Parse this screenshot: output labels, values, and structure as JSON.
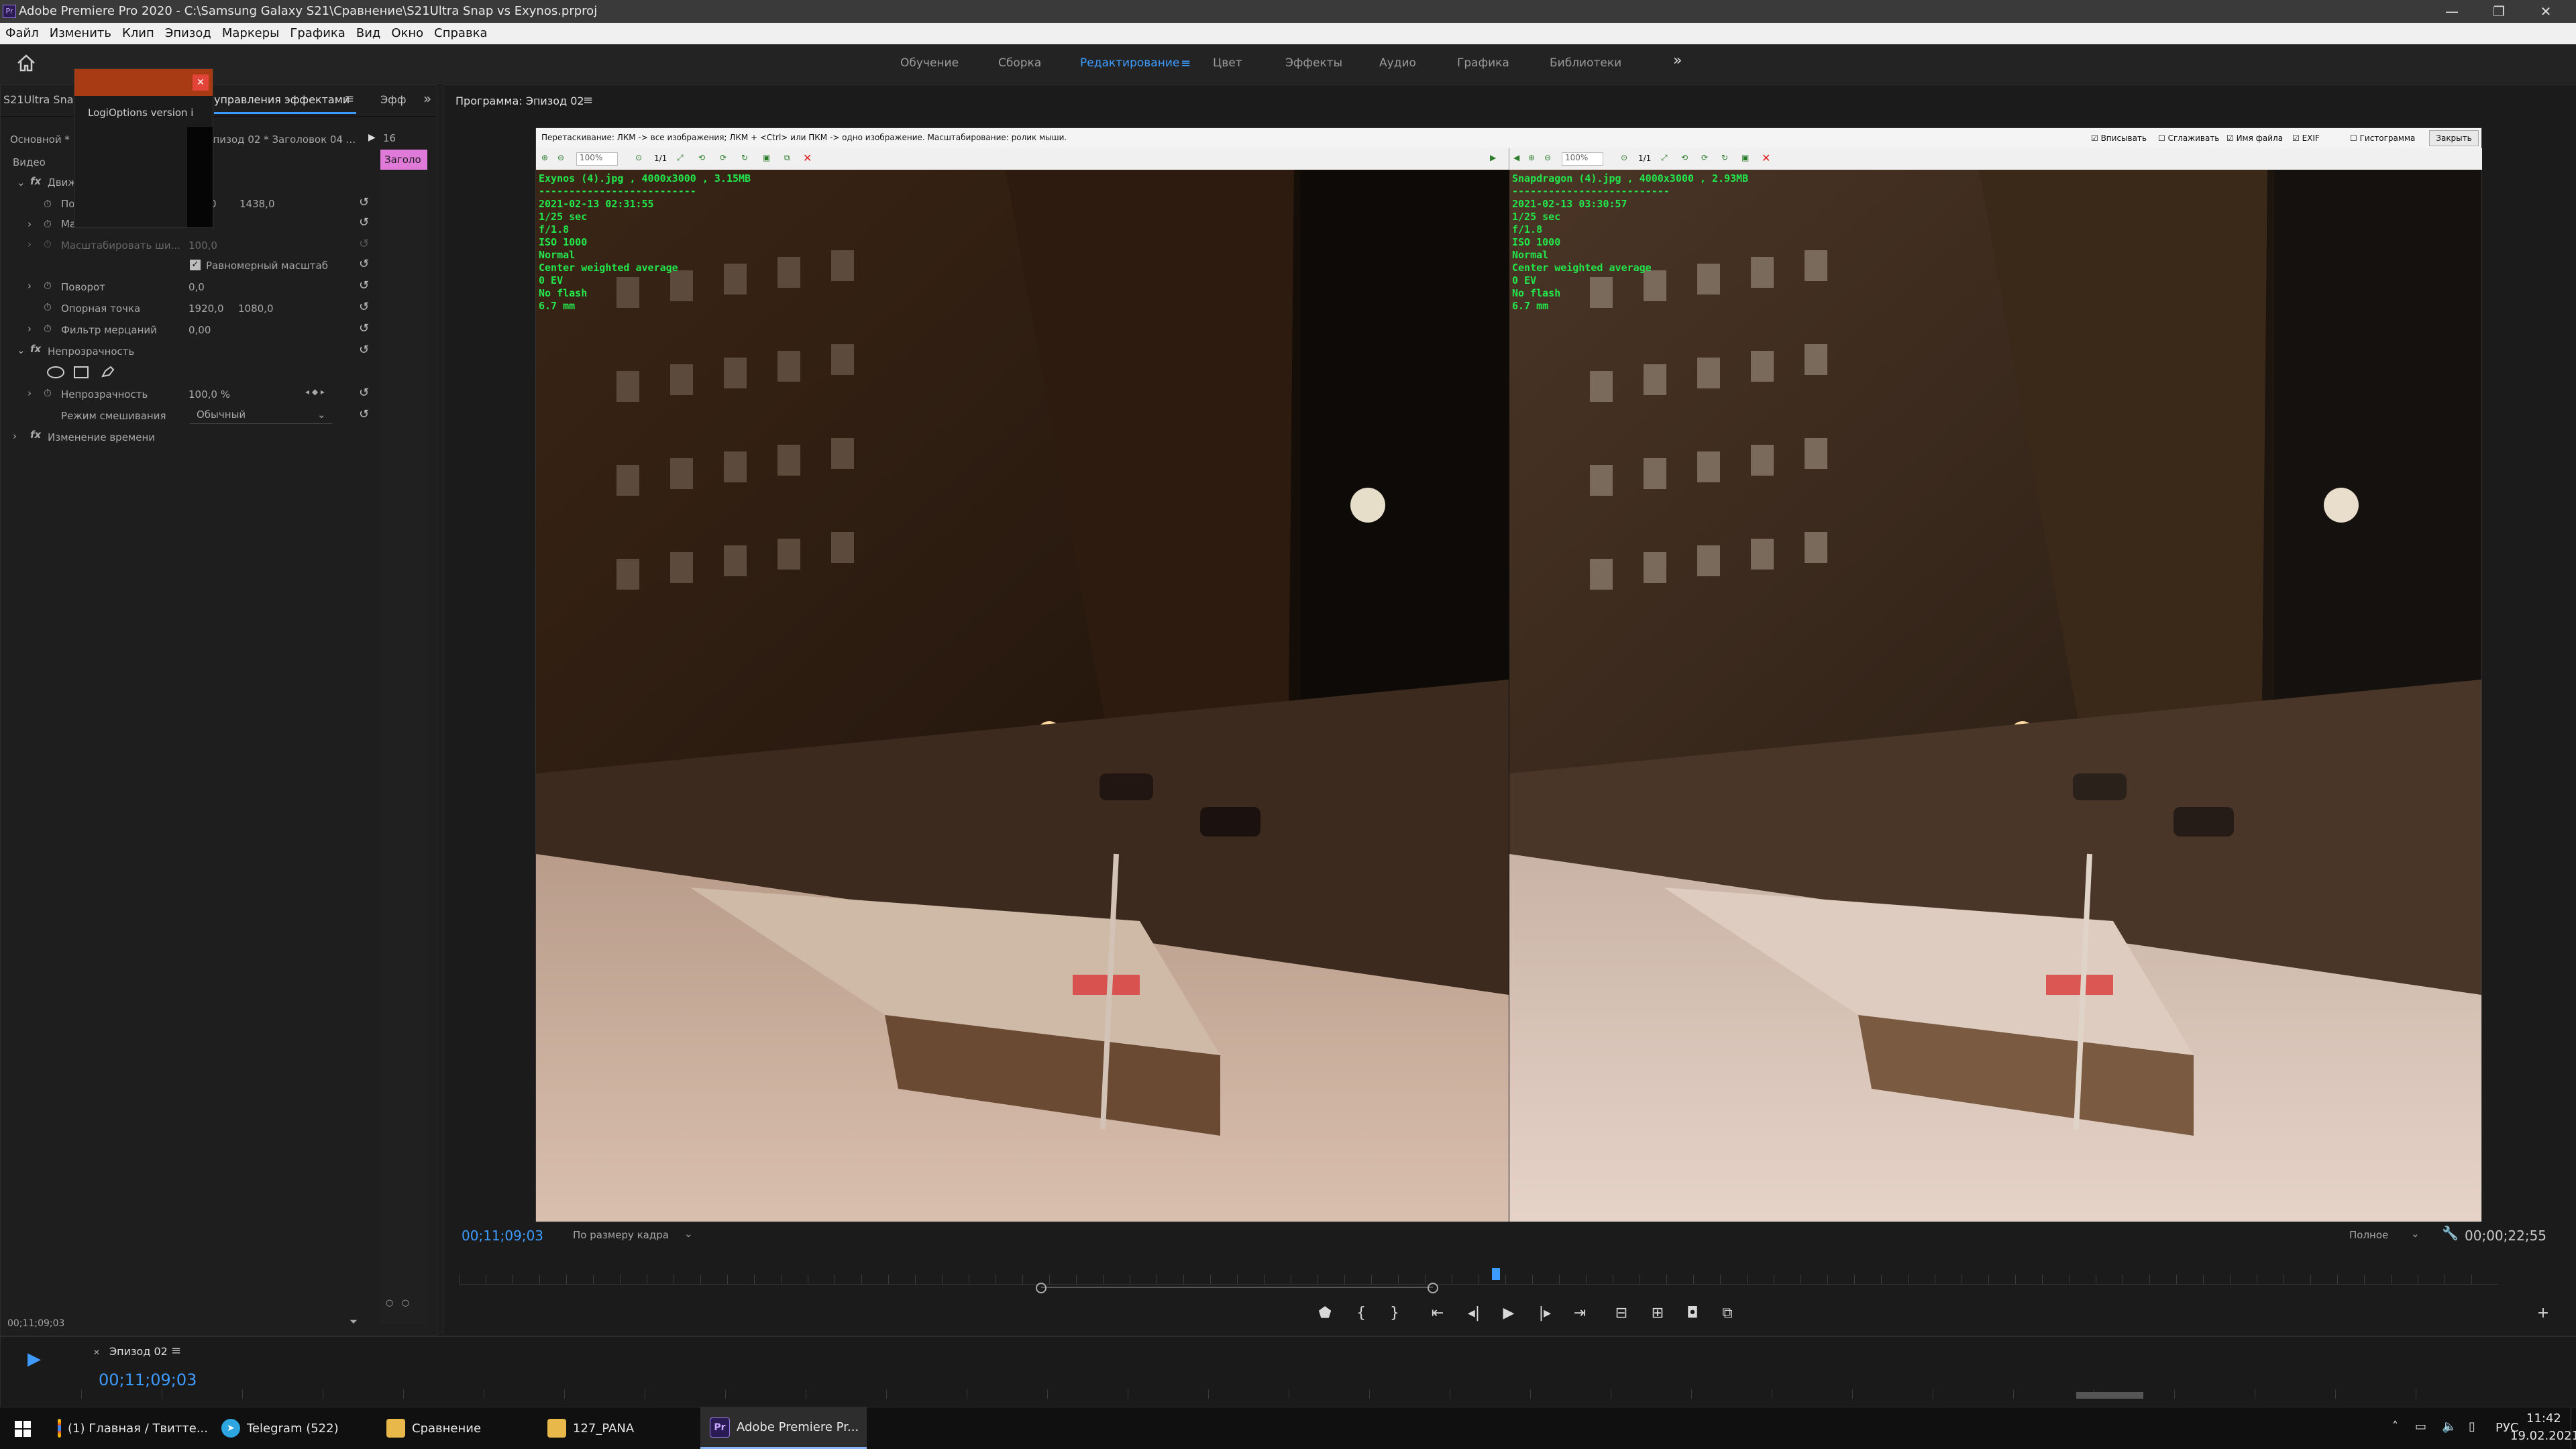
{
  "app": {
    "title": "Adobe Premiere Pro 2020 - C:\\Samsung Galaxy S21\\Сравнение\\S21Ultra Snap vs Exynos.prproj",
    "window_controls": {
      "minimize": "—",
      "maximize": "❐",
      "close": "✕"
    }
  },
  "menu": [
    "Файл",
    "Изменить",
    "Клип",
    "Эпизод",
    "Маркеры",
    "Графика",
    "Вид",
    "Окно",
    "Справка"
  ],
  "workspace": {
    "tabs": [
      "Обучение",
      "Сборка",
      "Редактирование",
      "Цвет",
      "Эффекты",
      "Аудио",
      "Графика",
      "Библиотеки"
    ],
    "active": "Редактирование",
    "more": "»"
  },
  "effect_controls": {
    "source_tab": "S21Ultra Snap vs",
    "panel_tab": "Элементы управления эффектами",
    "panel_tab_short": "управления эффектами",
    "fx_tab": "Эфф",
    "master_label": "Основной *",
    "clip_label": "Эпизод 02 * Заголовок 04 ...",
    "timecode_head": "16",
    "clip_chip": "Заголо",
    "section_video": "Видео",
    "motion": {
      "label": "Движение",
      "label_short": "Движ",
      "position_label": "По",
      "position_x": "0",
      "position_y": "1438,0",
      "scale_label": "Ма",
      "scale_width_label": "Масштабировать ши...",
      "scale_width_value": "100,0",
      "uniform_scale_label": "Равномерный масштаб",
      "rotation_label": "Поворот",
      "rotation_value": "0,0",
      "anchor_label": "Опорная точка",
      "anchor_x": "1920,0",
      "anchor_y": "1080,0",
      "flicker_label": "Фильтр мерцаний",
      "flicker_value": "0,00"
    },
    "opacity": {
      "label": "Непрозрачность",
      "value_label": "Непрозрачность",
      "value": "100,0 %",
      "blend_label": "Режим смешивания",
      "blend_value": "Обычный"
    },
    "time_remap_label": "Изменение времени",
    "footer_timecode": "00;11;09;03"
  },
  "popup": {
    "text": "LogiOptions version i",
    "close": "✕"
  },
  "program": {
    "title": "Программа: Эпизод 02",
    "timecode": "00;11;09;03",
    "fit": "По размеру кадра",
    "quality": "Полное",
    "duration": "00;00;22;55"
  },
  "comparer": {
    "hint": "Перетаскивание: ЛКМ -> все изображения; ЛКМ + <Ctrl> или ПКМ -> одно изображение. Масштабирование: ролик мыши.",
    "zoom_left": "100%",
    "zoom_right": "100%",
    "ratio_label": "1/1",
    "checkboxes": [
      {
        "label": "Вписывать",
        "checked": true
      },
      {
        "label": "Сглаживать",
        "checked": false
      },
      {
        "label": "Имя файла",
        "checked": true
      },
      {
        "label": "EXIF",
        "checked": true
      },
      {
        "label": "Гистограмма",
        "checked": false
      }
    ],
    "close_button": "Закрыть",
    "left_exif": [
      "Exynos (4).jpg , 4000x3000 , 3.15MB",
      "--------------------------",
      "2021-02-13 02:31:55",
      "1/25 sec",
      "f/1.8",
      "ISO 1000",
      "Normal",
      "Center weighted average",
      "0 EV",
      "No flash",
      "6.7 mm"
    ],
    "right_exif": [
      "Snapdragon (4).jpg , 4000x3000 , 2.93MB",
      "--------------------------",
      "2021-02-13 03:30:57",
      "1/25 sec",
      "f/1.8",
      "ISO 1000",
      "Normal",
      "Center weighted average",
      "0 EV",
      "No flash",
      "6.7 mm"
    ]
  },
  "timeline": {
    "tab": "Эпизод 02",
    "timecode": "00;11;09;03"
  },
  "taskbar": {
    "items": [
      {
        "label": "(1) Главная / Твитте...",
        "icon": "chrome-icon"
      },
      {
        "label": "Telegram (522)",
        "icon": "telegram-icon"
      },
      {
        "label": "Сравнение",
        "icon": "folder-icon"
      },
      {
        "label": "127_PANA",
        "icon": "folder-icon"
      },
      {
        "label": "Adobe Premiere Pr...",
        "icon": "premiere-icon"
      }
    ],
    "lang": "РУС",
    "time": "11:42",
    "date": "19.02.2021"
  },
  "colors": {
    "accent": "#3d9bff",
    "exif_text": "#22e64b",
    "title_bar": "#3a3a3a"
  }
}
